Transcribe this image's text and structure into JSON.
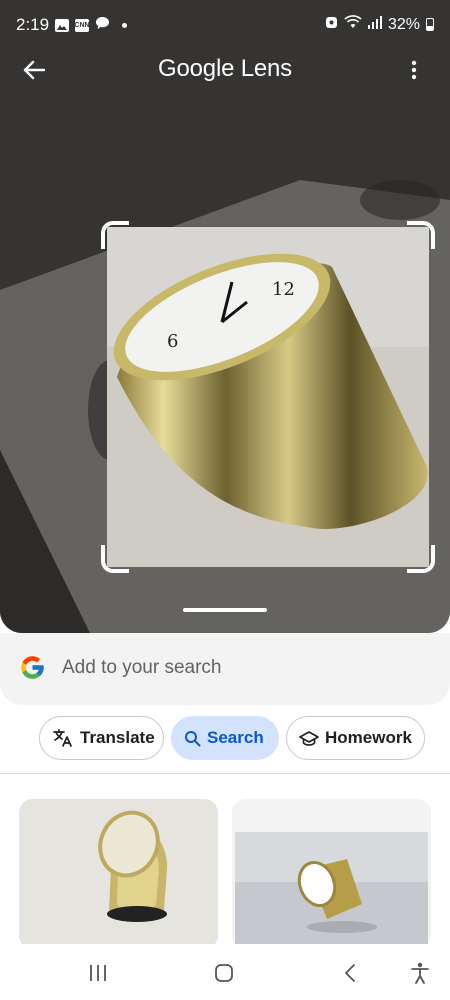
{
  "status_bar": {
    "time": "2:19",
    "notif_icons": [
      "image-icon",
      "cnn-icon",
      "chat-icon"
    ],
    "cnn_label": "CNN",
    "battery": "32%"
  },
  "app_bar": {
    "title": "Google Lens"
  },
  "search": {
    "placeholder": "Add to your search"
  },
  "chips": [
    {
      "label": "Translate",
      "icon": "translate-icon",
      "selected": false
    },
    {
      "label": "Search",
      "icon": "search-icon",
      "selected": true
    },
    {
      "label": "Homework",
      "icon": "school-cap-icon",
      "selected": false
    }
  ],
  "results": [
    {
      "icon": "clock-thumbnail"
    },
    {
      "icon": "clock-thumbnail"
    }
  ],
  "colors": {
    "accent": "#0b57d0",
    "chip_selected_bg": "#d3e3fd",
    "sheet_bg": "#f3f3f3"
  },
  "nav_bar": {
    "buttons": [
      "recents-icon",
      "home-icon",
      "back-icon",
      "accessibility-icon"
    ]
  }
}
